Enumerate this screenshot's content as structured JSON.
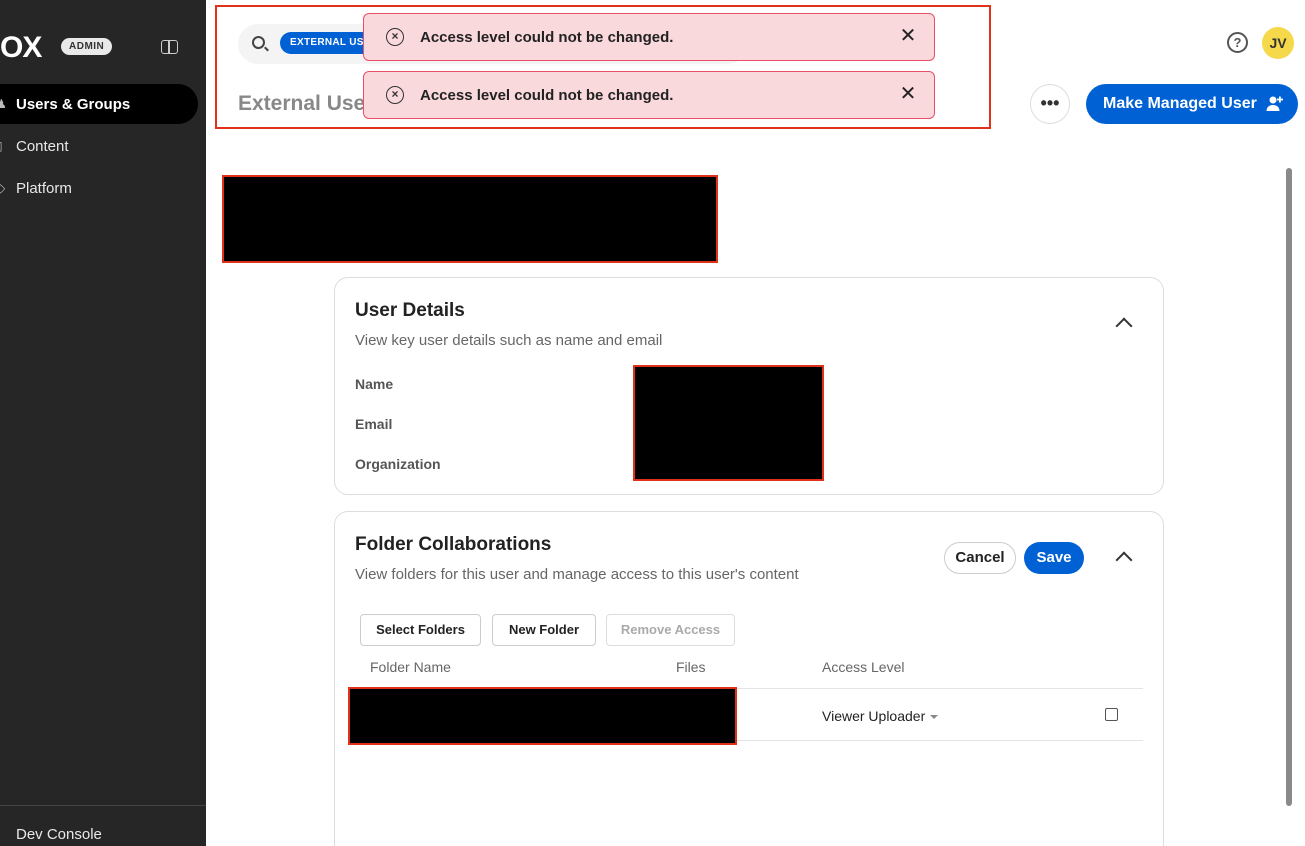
{
  "sidebar": {
    "logo": "OX",
    "badge": "ADMIN",
    "items": [
      {
        "label": "Users & Groups",
        "active": true
      },
      {
        "label": "Content",
        "active": false
      },
      {
        "label": "Platform",
        "active": false
      }
    ],
    "footer_item": "Dev Console"
  },
  "header": {
    "search_chip": "EXTERNAL USER",
    "page_title": "External User",
    "help_icon": "?",
    "avatar_initials": "JV",
    "more_label": "•••",
    "primary_action": "Make Managed User"
  },
  "toasts": [
    {
      "message": "Access level could not be changed.",
      "icon": "error-circle-x"
    },
    {
      "message": "Access level could not be changed.",
      "icon": "error-circle-x"
    }
  ],
  "user_details": {
    "title": "User Details",
    "subtitle": "View key user details such as name and email",
    "fields": [
      {
        "label": "Name"
      },
      {
        "label": "Email"
      },
      {
        "label": "Organization"
      }
    ]
  },
  "folder_collaborations": {
    "title": "Folder Collaborations",
    "subtitle": "View folders for this user and manage access to this user's content",
    "cancel_label": "Cancel",
    "save_label": "Save",
    "actions": {
      "select_folders": "Select Folders",
      "new_folder": "New Folder",
      "remove_access": "Remove Access"
    },
    "columns": {
      "folder_name": "Folder Name",
      "files": "Files",
      "access_level": "Access Level"
    },
    "rows": [
      {
        "access_level": "Viewer Uploader",
        "checked": false
      }
    ]
  },
  "colors": {
    "accent": "#0061d5",
    "sidebar_bg": "#262626",
    "toast_bg": "#fad9dc",
    "toast_border": "#e8506a",
    "highlight_border": "#e0321b",
    "avatar_bg": "#f5d94a"
  }
}
